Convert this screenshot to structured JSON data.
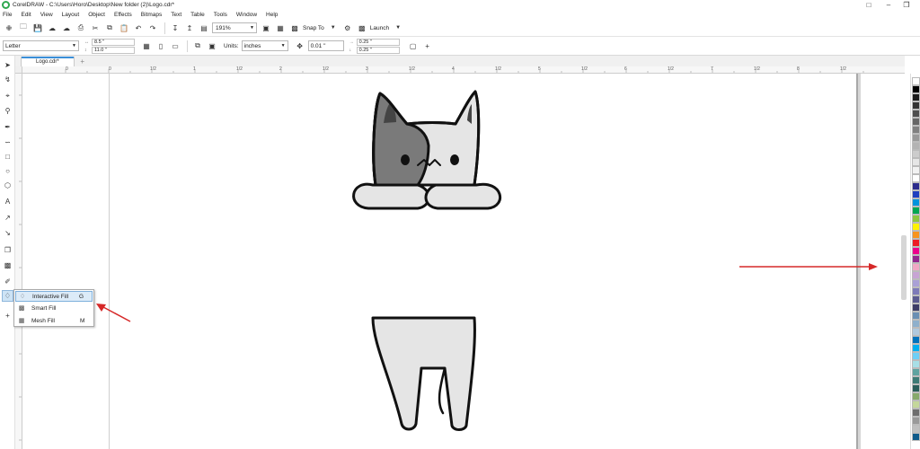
{
  "window": {
    "title": "CorelDRAW - C:\\Users\\Horo\\Desktop\\New folder (2)\\Logo.cdr*"
  },
  "menu": [
    "File",
    "Edit",
    "View",
    "Layout",
    "Object",
    "Effects",
    "Bitmaps",
    "Text",
    "Table",
    "Tools",
    "Window",
    "Help"
  ],
  "toolbar": {
    "zoom": "191%",
    "snap_to": "Snap To",
    "launch": "Launch"
  },
  "property_bar": {
    "page_size": "Letter",
    "width": "8.5 \"",
    "height": "11.0 \"",
    "units_label": "Units:",
    "units_value": "inches",
    "nudge": "0.01 \"",
    "dup_x": "0.25 \"",
    "dup_y": "0.25 \""
  },
  "document_tab": {
    "label": "Logo.cdr*"
  },
  "ruler": {
    "labels": [
      "0",
      "1/2",
      "1",
      "1/2",
      "2",
      "1/2",
      "3",
      "1/2",
      "4",
      "1/2",
      "5",
      "1/2",
      "6",
      "1/2",
      "7",
      "1/2",
      "8",
      "1/2"
    ]
  },
  "flyout": {
    "items": [
      {
        "label": "Interactive Fill",
        "shortcut": "G"
      },
      {
        "label": "Smart Fill",
        "shortcut": ""
      },
      {
        "label": "Mesh Fill",
        "shortcut": "M"
      }
    ]
  },
  "colors": {
    "cat_outline": "#111111",
    "cat_fill": "#e5e5e5",
    "cat_patch": "#7a7a7a",
    "annotation_arrow": "#d62828"
  },
  "palette": [
    "#ffffff",
    "#000000",
    "#1a1a1a",
    "#333333",
    "#4d4d4d",
    "#666666",
    "#808080",
    "#999999",
    "#b3b3b3",
    "#cccccc",
    "#e6e6e6",
    "#f2f2f2",
    "#ffffff",
    "#2b2b8c",
    "#1f3fbf",
    "#0093dd",
    "#00a651",
    "#8dc63f",
    "#fff200",
    "#f7941d",
    "#ed1c24",
    "#ec008c",
    "#92278f",
    "#f0a7c4",
    "#c7a4d4",
    "#a9a0d6",
    "#7d7ab8",
    "#5a5a8f",
    "#3d3d66",
    "#6a8fb3",
    "#8fb0cc",
    "#b0c8dd",
    "#0072bc",
    "#00aeef",
    "#6dcff6",
    "#a8dfe6",
    "#5fa3a0",
    "#3d7a75",
    "#2a5d59",
    "#87a96b",
    "#c4d79b",
    "#6e6e6e",
    "#999999",
    "#bfbfbf",
    "#0e5a8a"
  ]
}
